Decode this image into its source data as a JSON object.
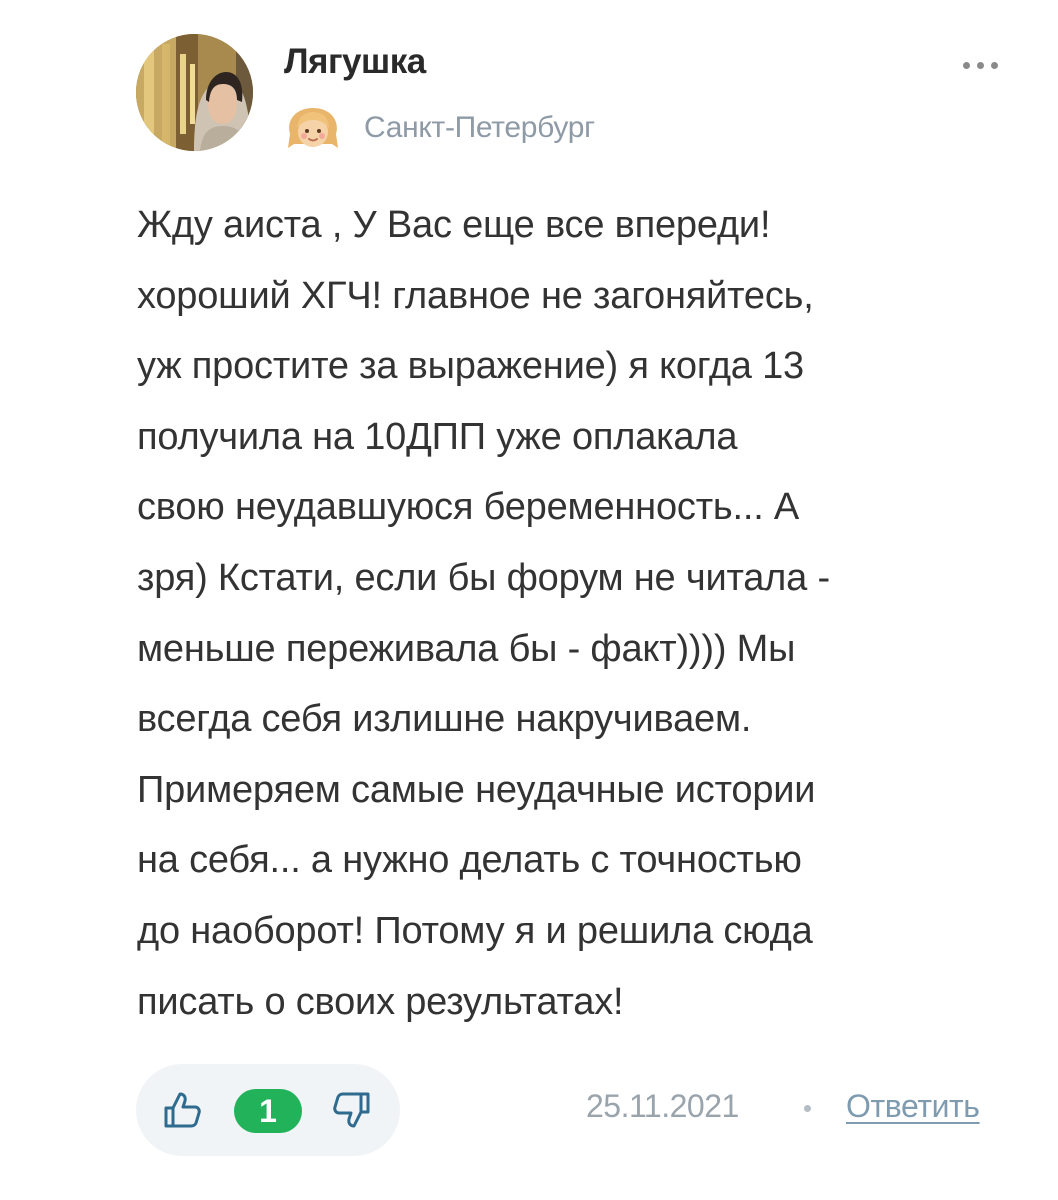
{
  "author": {
    "name": "Лягушка",
    "location": "Санкт-Петербург",
    "avatar_icon": "user-photo",
    "status_icon": "girl-face-icon"
  },
  "message": {
    "lines": [
      "Жду аиста , У Вас еще все впереди!",
      "хороший ХГЧ! главное не загоняйтесь,",
      "уж простите за выражение) я когда 13",
      "получила на 10ДПП уже оплакала",
      "свою неудавшуюся беременность... А",
      "зря) Кстати, если бы форум не читала -",
      "меньше переживала бы - факт)))) Мы",
      "всегда себя излишне накручиваем.",
      "Примеряем самые неудачные истории",
      "на себя... а нужно делать с точностью",
      "до наоборот! Потому я и решила сюда",
      "писать о своих результатах!"
    ]
  },
  "votes": {
    "score": "1",
    "like_icon": "thumbs-up-icon",
    "dislike_icon": "thumbs-down-icon"
  },
  "meta": {
    "date": "25.11.2021",
    "reply_label": "Ответить"
  },
  "menu": {
    "icon": "more-dots-icon"
  },
  "colors": {
    "accent_green": "#21b25a",
    "muted_text": "#9aa4ad",
    "link": "#7f9bb0",
    "location": "#8e9aa6"
  }
}
